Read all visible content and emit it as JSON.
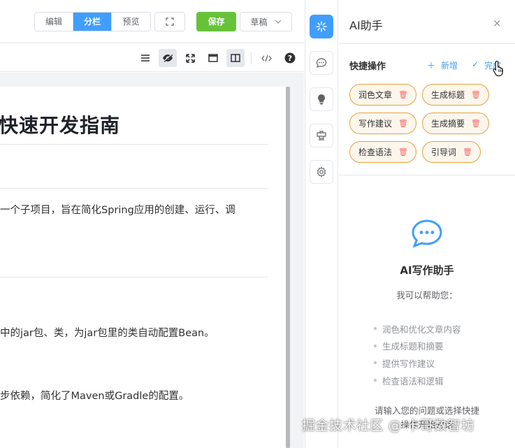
{
  "topbar": {
    "modes": [
      "编辑",
      "分栏",
      "预览"
    ],
    "active_mode": "分栏",
    "save_label": "保存",
    "draft_label": "草稿"
  },
  "editor_toolbar": {
    "icons": [
      "menu-icon",
      "eye-off-icon",
      "expand-icon",
      "window-icon",
      "split-view-icon",
      "code-icon",
      "help-icon"
    ]
  },
  "preview": {
    "title": "快速开发指南",
    "para1": "一个子项目，旨在简化Spring应用的创建、运行、调",
    "para2": "中的jar包、类，为jar包里的类自动配置Bean。",
    "para3": "步依赖，简化了Maven或Gradle的配置。"
  },
  "rail": {
    "icons": [
      "sparkle-icon",
      "chat-icon",
      "lightbulb-icon",
      "stamp-icon",
      "gear-icon"
    ]
  },
  "panel": {
    "title": "AI助手",
    "close": "×",
    "quick_actions": {
      "title": "快捷操作",
      "add_label": "新增",
      "done_label": "完成",
      "chips": [
        "润色文章",
        "生成标题",
        "写作建议",
        "生成摘要",
        "检查语法",
        "引导词"
      ]
    },
    "empty_state": {
      "title": "AI写作助手",
      "subtitle": "我可以帮助您：",
      "features": [
        "润色和优化文章内容",
        "生成标题和摘要",
        "提供写作建议",
        "检查语法和逻辑"
      ],
      "hint_line1": "请输入您的问题或选择快捷",
      "hint_line2": "操作开始对话"
    }
  },
  "watermark": "掘金技术社区 @ 卡哥数智坊",
  "colors": {
    "primary": "#409eff",
    "success": "#67c23a",
    "chip_border": "#e6a23c",
    "chip_bg": "#fdf6ec",
    "danger": "#f56c6c"
  }
}
